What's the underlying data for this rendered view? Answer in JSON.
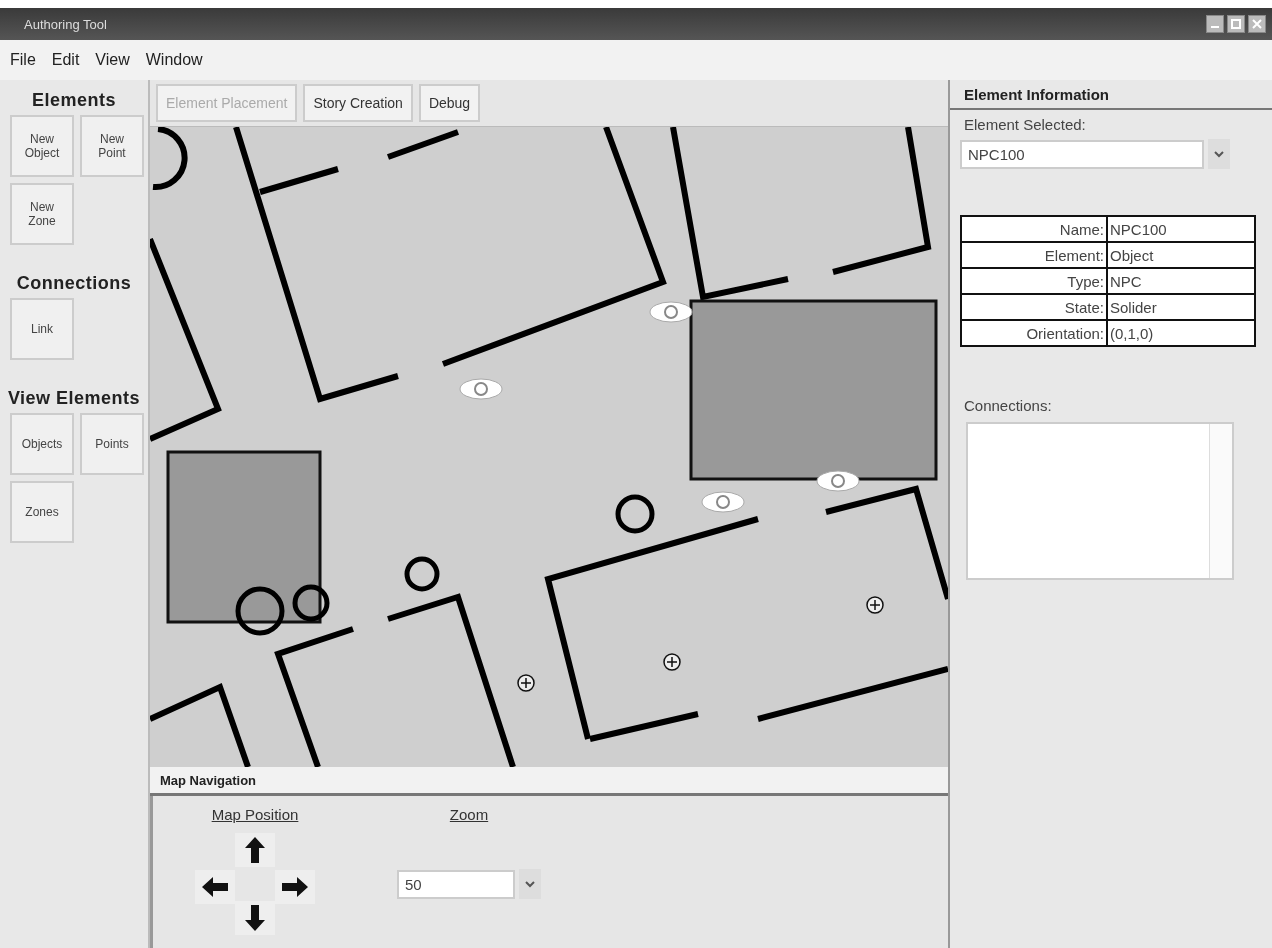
{
  "window": {
    "title": "Authoring Tool"
  },
  "menu": [
    "File",
    "Edit",
    "View",
    "Window"
  ],
  "left_panel": [
    {
      "title": "Elements",
      "buttons": [
        "New Object",
        "New Point",
        "New Zone"
      ]
    },
    {
      "title": "Connections",
      "buttons": [
        "Link"
      ]
    },
    {
      "title": "View Elements",
      "buttons": [
        "Objects",
        "Points",
        "Zones"
      ]
    }
  ],
  "tabs": [
    {
      "label": "Element Placement",
      "selected": true
    },
    {
      "label": "Story Creation",
      "selected": false
    },
    {
      "label": "Debug",
      "selected": false
    }
  ],
  "map_navigation": {
    "title": "Map Navigation",
    "position_label": "Map Position",
    "zoom_label": "Zoom",
    "zoom_value": "50"
  },
  "element_information": {
    "title": "Element Information",
    "selected_label": "Element Selected:",
    "selected_value": "NPC100",
    "properties": [
      {
        "label": "Name:",
        "value": "NPC100"
      },
      {
        "label": "Element:",
        "value": "Object"
      },
      {
        "label": "Type:",
        "value": "NPC"
      },
      {
        "label": "State:",
        "value": "Solider"
      },
      {
        "label": "Orientation:",
        "value": "(0,1,0)"
      }
    ],
    "connections_label": "Connections:"
  }
}
